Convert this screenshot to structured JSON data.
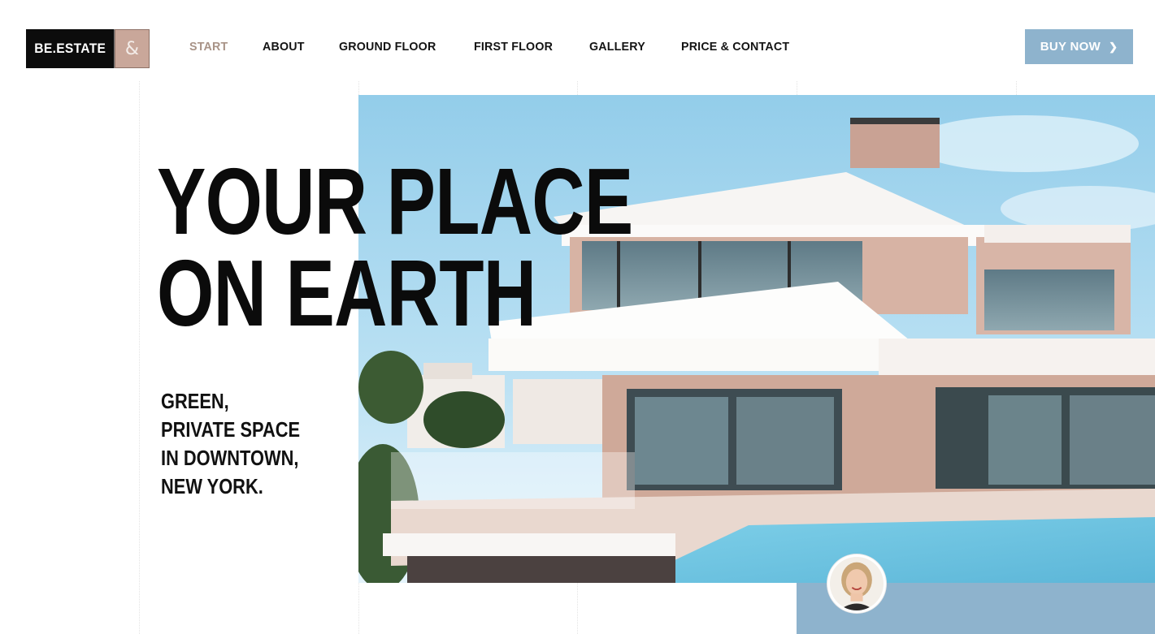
{
  "logo": {
    "text": "BE.ESTATE",
    "mark": "&"
  },
  "nav": {
    "items": [
      {
        "label": "START",
        "active": true
      },
      {
        "label": "ABOUT",
        "active": false
      },
      {
        "label": "GROUND FLOOR",
        "active": false
      },
      {
        "label": "FIRST FLOOR",
        "active": false
      },
      {
        "label": "GALLERY",
        "active": false
      },
      {
        "label": "PRICE & CONTACT",
        "active": false
      }
    ]
  },
  "cta": {
    "label": "BUY NOW",
    "icon": "chevron-right-icon"
  },
  "hero": {
    "headline": [
      "YOUR PLACE",
      "ON EARTH"
    ],
    "subline": [
      "GREEN,",
      "PRIVATE SPACE",
      "IN DOWNTOWN,",
      "NEW YORK."
    ]
  },
  "colors": {
    "accent": "#8eb3cd",
    "active_nav": "#a89387",
    "logo_mark": "#c9a79a",
    "text": "#0b0b0b"
  }
}
